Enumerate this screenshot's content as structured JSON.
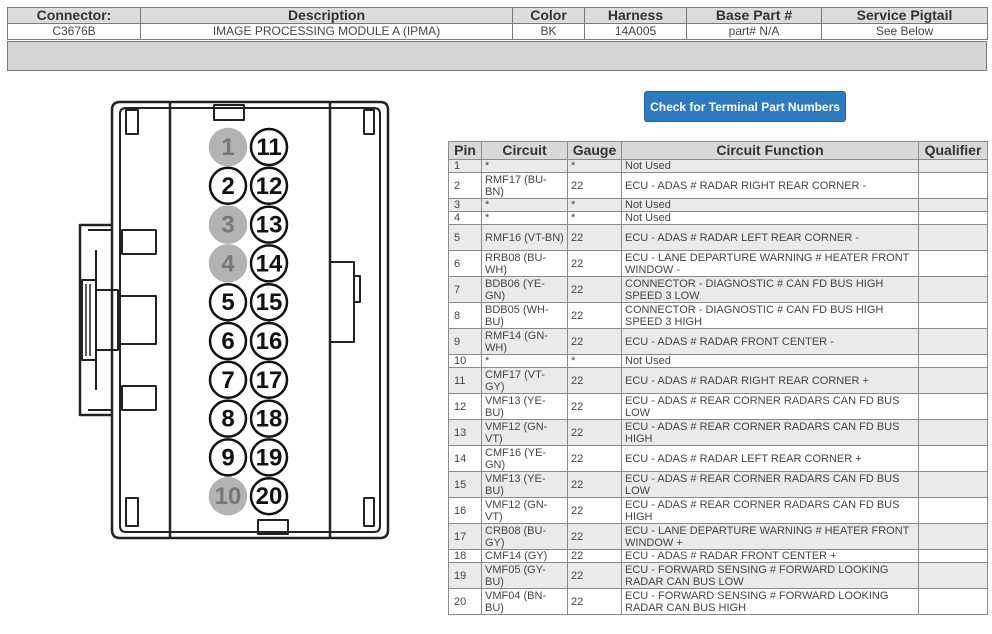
{
  "connector_info": {
    "headers": [
      "Connector:",
      "Description",
      "Color",
      "Harness",
      "Base Part #",
      "Service Pigtail"
    ],
    "values": [
      "C3676B",
      "IMAGE PROCESSING MODULE A (IPMA)",
      "BK",
      "14A005",
      "part# N/A",
      "See Below"
    ]
  },
  "terminal_button": "Check for Terminal Part Numbers",
  "connector_diagram": {
    "pins_left": [
      "1",
      "2",
      "3",
      "4",
      "5",
      "6",
      "7",
      "8",
      "9",
      "10"
    ],
    "pins_right": [
      "11",
      "12",
      "13",
      "14",
      "15",
      "16",
      "17",
      "18",
      "19",
      "20"
    ],
    "unused_pins": [
      "1",
      "3",
      "4",
      "10"
    ],
    "unused_fill": "#b3b3b3"
  },
  "pin_table": {
    "headers": [
      "Pin",
      "Circuit",
      "Gauge",
      "Circuit Function",
      "Qualifier"
    ],
    "rows": [
      {
        "pin": "1",
        "circuit": "*",
        "gauge": "*",
        "function": "Not Used",
        "qualifier": ""
      },
      {
        "pin": "2",
        "circuit": "RMF17 (BU-BN)",
        "gauge": "22",
        "function": "ECU - ADAS # RADAR RIGHT REAR CORNER -",
        "qualifier": ""
      },
      {
        "pin": "3",
        "circuit": "*",
        "gauge": "*",
        "function": "Not Used",
        "qualifier": ""
      },
      {
        "pin": "4",
        "circuit": "*",
        "gauge": "*",
        "function": "Not Used",
        "qualifier": ""
      },
      {
        "pin": "5",
        "circuit": "RMF16 (VT-BN)",
        "gauge": "22",
        "function": "ECU - ADAS # RADAR LEFT REAR CORNER -",
        "qualifier": ""
      },
      {
        "pin": "6",
        "circuit": "RRB08 (BU-WH)",
        "gauge": "22",
        "function": "ECU - LANE DEPARTURE WARNING # HEATER FRONT WINDOW -",
        "qualifier": ""
      },
      {
        "pin": "7",
        "circuit": "BDB06 (YE-GN)",
        "gauge": "22",
        "function": "CONNECTOR - DIAGNOSTIC # CAN FD BUS HIGH SPEED 3 LOW",
        "qualifier": ""
      },
      {
        "pin": "8",
        "circuit": "BDB05 (WH-BU)",
        "gauge": "22",
        "function": "CONNECTOR - DIAGNOSTIC # CAN FD BUS HIGH SPEED 3 HIGH",
        "qualifier": ""
      },
      {
        "pin": "9",
        "circuit": "RMF14 (GN-WH)",
        "gauge": "22",
        "function": "ECU - ADAS # RADAR FRONT CENTER -",
        "qualifier": ""
      },
      {
        "pin": "10",
        "circuit": "*",
        "gauge": "*",
        "function": "Not Used",
        "qualifier": ""
      },
      {
        "pin": "11",
        "circuit": "CMF17 (VT-GY)",
        "gauge": "22",
        "function": "ECU - ADAS # RADAR RIGHT REAR CORNER +",
        "qualifier": ""
      },
      {
        "pin": "12",
        "circuit": "VMF13 (YE-BU)",
        "gauge": "22",
        "function": "ECU - ADAS # REAR CORNER RADARS CAN FD BUS LOW",
        "qualifier": ""
      },
      {
        "pin": "13",
        "circuit": "VMF12 (GN-VT)",
        "gauge": "22",
        "function": "ECU - ADAS # REAR CORNER RADARS CAN FD BUS HIGH",
        "qualifier": ""
      },
      {
        "pin": "14",
        "circuit": "CMF16 (YE-GN)",
        "gauge": "22",
        "function": "ECU - ADAS # RADAR LEFT REAR CORNER +",
        "qualifier": ""
      },
      {
        "pin": "15",
        "circuit": "VMF13 (YE-BU)",
        "gauge": "22",
        "function": "ECU - ADAS # REAR CORNER RADARS CAN FD BUS LOW",
        "qualifier": ""
      },
      {
        "pin": "16",
        "circuit": "VMF12 (GN-VT)",
        "gauge": "22",
        "function": "ECU - ADAS # REAR CORNER RADARS CAN FD BUS HIGH",
        "qualifier": ""
      },
      {
        "pin": "17",
        "circuit": "CRB08 (BU-GY)",
        "gauge": "22",
        "function": "ECU - LANE DEPARTURE WARNING # HEATER FRONT WINDOW +",
        "qualifier": ""
      },
      {
        "pin": "18",
        "circuit": "CMF14 (GY)",
        "gauge": "22",
        "function": "ECU - ADAS # RADAR FRONT CENTER +",
        "qualifier": ""
      },
      {
        "pin": "19",
        "circuit": "VMF05 (GY-BU)",
        "gauge": "22",
        "function": "ECU - FORWARD SENSING # FORWARD LOOKING RADAR CAN BUS LOW",
        "qualifier": ""
      },
      {
        "pin": "20",
        "circuit": "VMF04 (BN-BU)",
        "gauge": "22",
        "function": "ECU - FORWARD SENSING # FORWARD LOOKING RADAR CAN BUS HIGH",
        "qualifier": ""
      }
    ]
  }
}
